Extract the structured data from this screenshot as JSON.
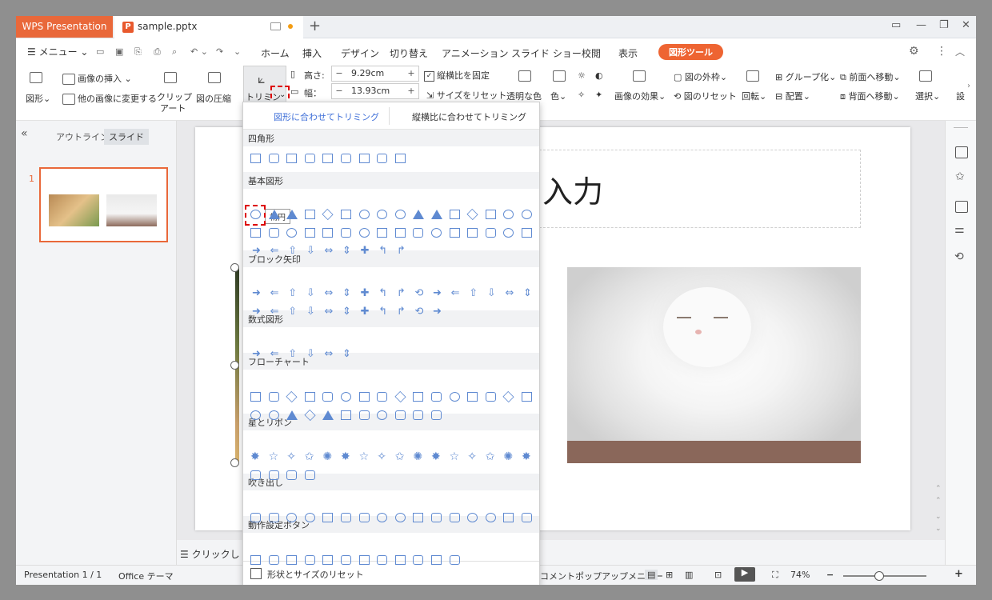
{
  "titlebar": {
    "app_tab": "WPS Presentation",
    "doc_tab": "sample.pptx",
    "new_tab": "+"
  },
  "menubar": {
    "menu_label": "メニュー",
    "tabs": [
      "ホーム",
      "挿入",
      "デザイン",
      "切り替え",
      "アニメーション",
      "スライド ショー",
      "校閲",
      "表示",
      "図形ツール"
    ],
    "active_tab": "図形ツール"
  },
  "ribbon": {
    "shape": "図形",
    "insert_image": "画像の挿入",
    "change_image": "他の画像に変更する",
    "clip_art_1": "クリップ",
    "clip_art_2": "アート",
    "compress": "図の圧縮",
    "trim": "トリミング",
    "height_label": "高さ:",
    "height_value": "9.29cm",
    "width_label": "幅：",
    "width_value": "13.93cm",
    "lock_aspect": "縦横比を固定",
    "reset_size": "サイズをリセット",
    "transparent": "透明な色",
    "color": "色",
    "image_effect": "画像の効果",
    "outline": "図の外枠",
    "reset_pic": "図のリセット",
    "rotate": "回転",
    "group": "グループ化",
    "align": "配置",
    "bring_forward": "前面へ移動",
    "send_backward": "背面へ移動",
    "select": "選択",
    "settings": "設"
  },
  "leftpanel": {
    "tab_outline": "アウトライン",
    "tab_slide": "スライド",
    "slide_number": "1"
  },
  "slide": {
    "title_text": "入力",
    "notes_placeholder": "クリックし"
  },
  "dropdown": {
    "option_fit_shape": "図形に合わせてトリミング",
    "option_fit_ratio": "縦横比に合わせてトリミング",
    "categories": [
      "四角形",
      "基本図形",
      "ブロック矢印",
      "数式図形",
      "フローチャート",
      "星とリボン",
      "吹き出し",
      "動作設定ボタン"
    ],
    "tooltip": "楕円",
    "reset_label": "形状とサイズのリセット"
  },
  "status": {
    "presentation": "Presentation 1 / 1",
    "theme": "Office テーマ",
    "comment_popup": "コメントポップアップメニュー",
    "zoom": "74%"
  }
}
